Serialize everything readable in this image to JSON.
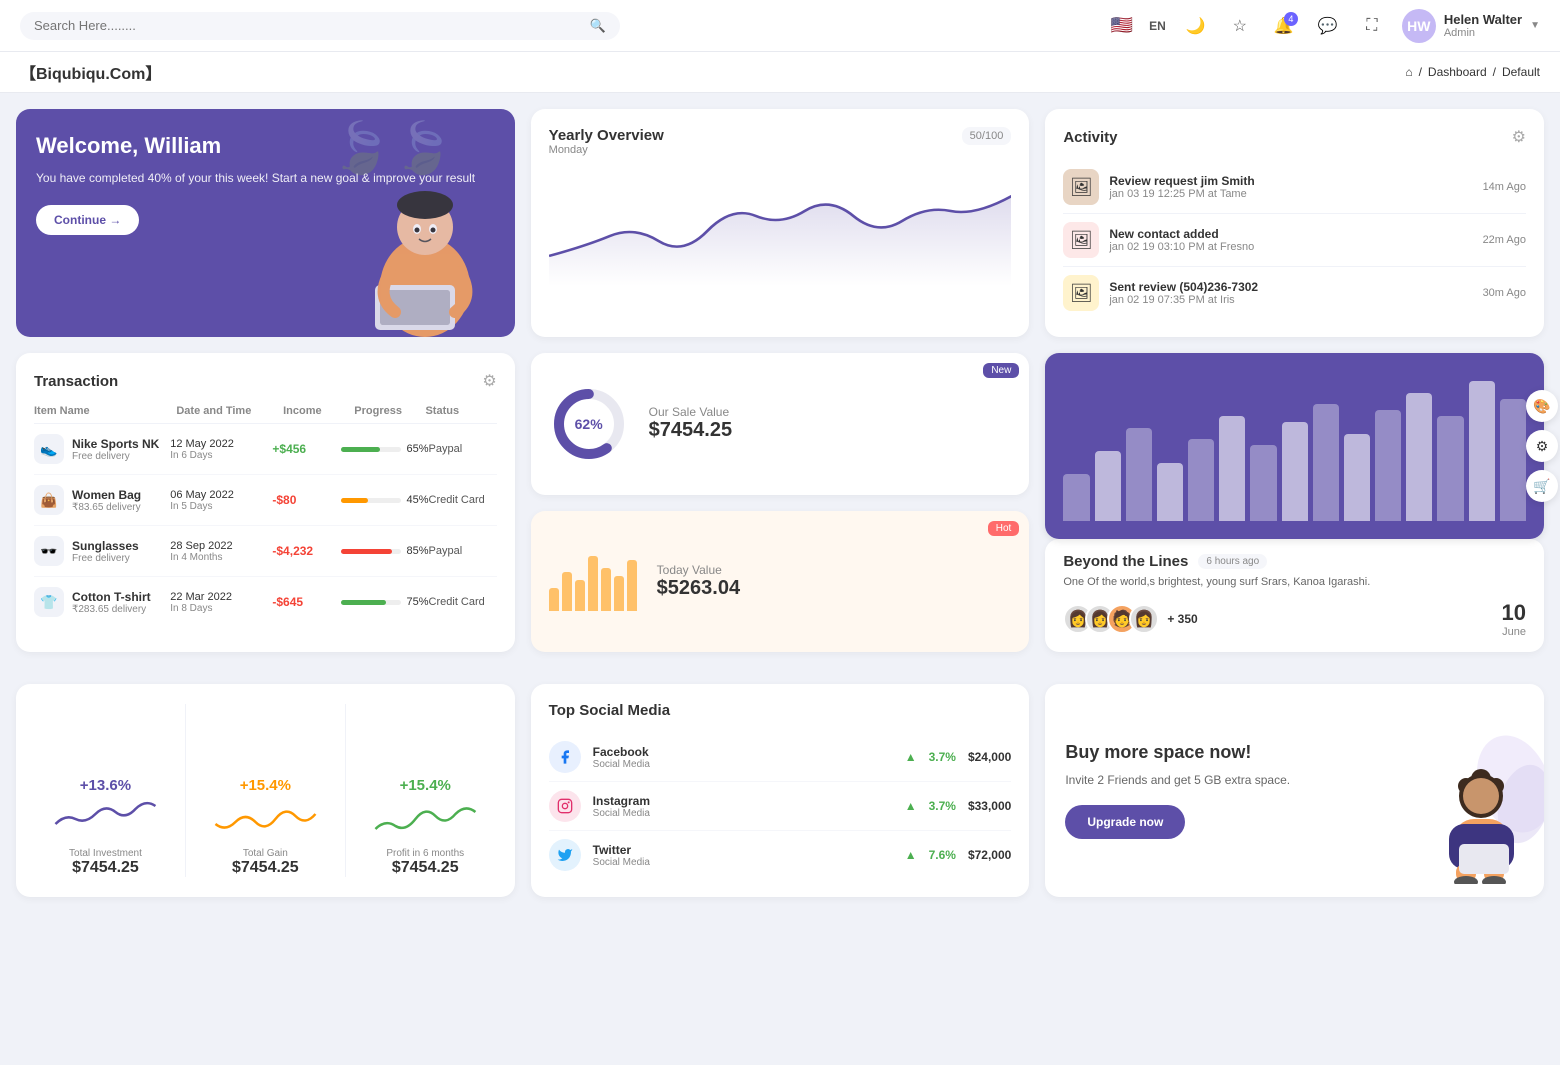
{
  "topnav": {
    "search_placeholder": "Search Here........",
    "lang": "EN",
    "bell_badge": "4",
    "user_name": "Helen Walter",
    "user_role": "Admin"
  },
  "breadcrumb": {
    "brand": "【Biqubiqu.Com】",
    "home": "⌂",
    "items": [
      "Dashboard",
      "Default"
    ]
  },
  "welcome": {
    "greeting": "Welcome, William",
    "subtitle": "You have completed 40% of your this week! Start a new goal & improve your result",
    "button": "Continue →"
  },
  "yearly": {
    "title": "Yearly Overview",
    "subtitle": "Monday",
    "progress": "50/100"
  },
  "activity": {
    "title": "Activity",
    "items": [
      {
        "title": "Review request jim Smith",
        "time": "jan 03 19 12:25 PM at Tame",
        "ago": "14m Ago"
      },
      {
        "title": "New contact added",
        "time": "jan 02 19 03:10 PM at Fresno",
        "ago": "22m Ago"
      },
      {
        "title": "Sent review (504)236-7302",
        "time": "jan 02 19 07:35 PM at Iris",
        "ago": "30m Ago"
      }
    ]
  },
  "transaction": {
    "title": "Transaction",
    "headers": [
      "Item Name",
      "Date and Time",
      "Income",
      "Progress",
      "Status"
    ],
    "rows": [
      {
        "icon": "👟",
        "name": "Nike Sports NK",
        "sub": "Free delivery",
        "date": "12 May 2022",
        "days": "In 6 Days",
        "income": "+$456",
        "positive": true,
        "progress": 65,
        "progress_color": "#4caf50",
        "status": "Paypal"
      },
      {
        "icon": "👜",
        "name": "Women Bag",
        "sub": "₹83.65 delivery",
        "date": "06 May 2022",
        "days": "In 5 Days",
        "income": "-$80",
        "positive": false,
        "progress": 45,
        "progress_color": "#ff9800",
        "status": "Credit Card"
      },
      {
        "icon": "🕶️",
        "name": "Sunglasses",
        "sub": "Free delivery",
        "date": "28 Sep 2022",
        "days": "In 4 Months",
        "income": "-$4,232",
        "positive": false,
        "progress": 85,
        "progress_color": "#f44336",
        "status": "Paypal"
      },
      {
        "icon": "👕",
        "name": "Cotton T-shirt",
        "sub": "₹283.65 delivery",
        "date": "22 Mar 2022",
        "days": "In 8 Days",
        "income": "-$645",
        "positive": false,
        "progress": 75,
        "progress_color": "#4caf50",
        "status": "Credit Card"
      }
    ]
  },
  "sale_value": {
    "label": "Our Sale Value",
    "value": "$7454.25",
    "percent": "62%",
    "badge": "New"
  },
  "today_value": {
    "label": "Today Value",
    "value": "$5263.04",
    "badge": "Hot",
    "bars": [
      30,
      50,
      40,
      70,
      55,
      45,
      65
    ]
  },
  "bar_chart": {
    "bars": [
      40,
      60,
      80,
      50,
      70,
      90,
      65,
      85,
      100,
      75,
      95,
      110,
      90,
      120,
      105
    ]
  },
  "beyond": {
    "title": "Beyond the Lines",
    "time_ago": "6 hours ago",
    "description": "One Of the world,s brightest, young surf Srars, Kanoa Igarashi.",
    "plus_count": "+ 350",
    "date_num": "10",
    "date_month": "June"
  },
  "mini_stats": [
    {
      "pct": "+13.6%",
      "label": "Total Investment",
      "value": "$7454.25",
      "color": "#5d4fa8",
      "wave_color": "#5d4fa8"
    },
    {
      "pct": "+15.4%",
      "label": "Total Gain",
      "value": "$7454.25",
      "color": "#ff9800",
      "wave_color": "#ff9800"
    },
    {
      "pct": "+15.4%",
      "label": "Profit in 6 months",
      "value": "$7454.25",
      "color": "#4caf50",
      "wave_color": "#4caf50"
    }
  ],
  "social_media": {
    "title": "Top Social Media",
    "items": [
      {
        "name": "Facebook",
        "type": "Social Media",
        "pct": "3.7%",
        "value": "$24,000",
        "icon": "f"
      },
      {
        "name": "Instagram",
        "type": "Social Media",
        "pct": "3.7%",
        "value": "$33,000",
        "icon": "ig"
      },
      {
        "name": "Twitter",
        "type": "Social Media",
        "pct": "7.6%",
        "value": "$72,000",
        "icon": "tw"
      }
    ]
  },
  "upgrade": {
    "title": "Buy more space now!",
    "description": "Invite 2 Friends and get 5 GB extra space.",
    "button": "Upgrade now"
  }
}
